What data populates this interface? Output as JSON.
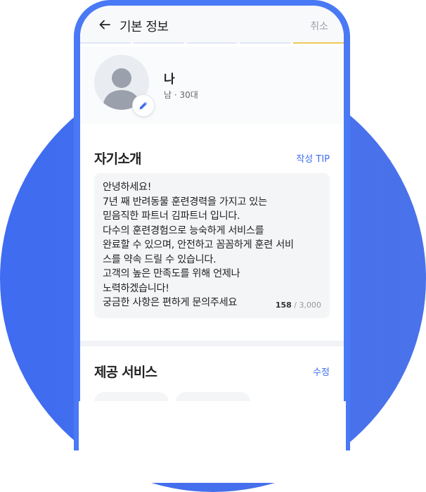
{
  "header": {
    "title": "기본 정보",
    "cancel_label": "취소",
    "progress_steps": 5,
    "progress_active_index": 4
  },
  "profile": {
    "name": "나",
    "meta": "남 · 30대"
  },
  "intro": {
    "title": "자기소개",
    "tip_label": "작성 TIP",
    "lines": [
      "안녕하세요!",
      "7년 째 반려동물 훈련경력을 가지고 있는",
      "믿음직한 파트너 김파트너 입니다.",
      "다수의 훈련경험으로 능숙하게 서비스를",
      "완료할 수 있으며, 안전하고 꼼꼼하게 훈련 서비",
      "스를 약속 드릴 수 있습니다.",
      "고객의 높은 만족도를 위해 언제나",
      "노력하겠습니다!",
      "궁금한 사항은 편하게 문의주세요"
    ],
    "char_count": "158",
    "char_limit": "/ 3,000"
  },
  "services": {
    "title": "제공 서비스",
    "edit_label": "수정"
  },
  "colors": {
    "accent": "#3f6cf0",
    "progress_active": "#f0c85a"
  }
}
